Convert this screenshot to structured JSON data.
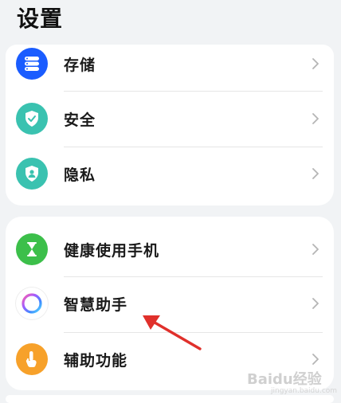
{
  "page_title": "设置",
  "groups": [
    {
      "items": [
        {
          "label": "存储",
          "icon": "storage-icon",
          "color": "#1a5cff"
        },
        {
          "label": "安全",
          "icon": "shield-check-icon",
          "color": "#3ac2b0"
        },
        {
          "label": "隐私",
          "icon": "privacy-shield-icon",
          "color": "#3ac2b0"
        }
      ]
    },
    {
      "items": [
        {
          "label": "健康使用手机",
          "icon": "hourglass-icon",
          "color": "#3cbf4a"
        },
        {
          "label": "智慧助手",
          "icon": "smart-assistant-icon",
          "color": "#ffffff"
        },
        {
          "label": "辅助功能",
          "icon": "hand-tap-icon",
          "color": "#f7a12a"
        }
      ]
    }
  ],
  "watermark": {
    "text": "Baidu经验",
    "sub": "jingyan.baidu.com"
  }
}
